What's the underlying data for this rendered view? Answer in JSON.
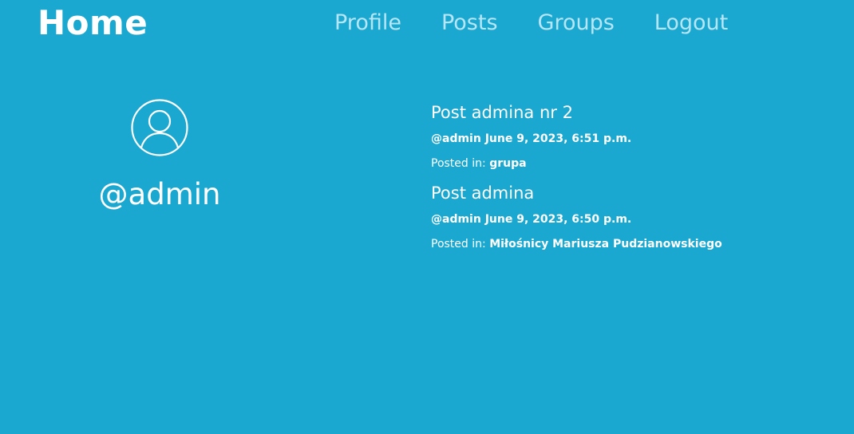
{
  "header": {
    "brand": "Home",
    "nav": [
      {
        "label": "Profile"
      },
      {
        "label": "Posts"
      },
      {
        "label": "Groups"
      },
      {
        "label": "Logout"
      }
    ]
  },
  "profile": {
    "avatar_icon": "user-circle-icon",
    "username": "@admin"
  },
  "posts": [
    {
      "title": "Post admina nr 2",
      "author": "@admin",
      "date": "June 9, 2023, 6:51 p.m.",
      "posted_in_label": "Posted in:",
      "group": "grupa"
    },
    {
      "title": "Post admina",
      "author": "@admin",
      "date": "June 9, 2023, 6:50 p.m.",
      "posted_in_label": "Posted in:",
      "group": "Miłośnicy Mariusza Pudzianowskiego"
    }
  ],
  "colors": {
    "background": "#1aa8d1",
    "nav_link": "#b6e6f5",
    "text": "#ffffff"
  }
}
